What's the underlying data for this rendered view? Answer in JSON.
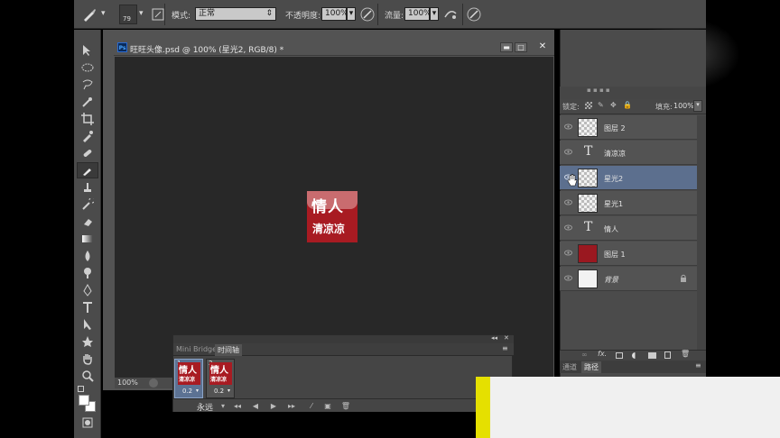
{
  "options_bar": {
    "brush_size": "79",
    "mode_label": "模式:",
    "mode_value": "正常",
    "opacity_label": "不透明度:",
    "opacity_value": "100%",
    "flow_label": "流量:",
    "flow_value": "100%"
  },
  "document": {
    "tab_title": "旺旺头像.psd @ 100% (星光2, RGB/8) *",
    "app_badge": "Ps",
    "zoom": "100%",
    "artwork": {
      "line1": "情人",
      "line2": "清凉凉",
      "color": "#a81b22"
    }
  },
  "timeline": {
    "tabs": [
      "Mini Bridge",
      "时间轴"
    ],
    "active_tab": "时间轴",
    "frames": [
      {
        "number": "1",
        "delay": "0.2",
        "thumb_line1": "情人",
        "thumb_line2": "清凉凉",
        "selected": true
      },
      {
        "number": "2",
        "delay": "0.2",
        "thumb_line1": "情人",
        "thumb_line2": "清凉凉",
        "selected": false
      }
    ],
    "loop": "永远"
  },
  "layers_panel": {
    "lock_label": "锁定:",
    "fill_label": "填充:",
    "fill_value": "100%",
    "layers": [
      {
        "name": "图层 2",
        "kind": "pixel",
        "thumb": "transparent",
        "selected": false
      },
      {
        "name": "清凉凉",
        "kind": "text",
        "thumb": "text",
        "selected": false
      },
      {
        "name": "星光2",
        "kind": "pixel",
        "thumb": "transparent",
        "selected": true
      },
      {
        "name": "星光1",
        "kind": "pixel",
        "thumb": "transparent",
        "selected": false
      },
      {
        "name": "情人",
        "kind": "text",
        "thumb": "text",
        "selected": false
      },
      {
        "name": "图层 1",
        "kind": "pixel",
        "thumb": "red",
        "selected": false
      },
      {
        "name": "背景",
        "kind": "background",
        "thumb": "white",
        "selected": false,
        "locked": true
      }
    ],
    "bottom_tabs": [
      "通道",
      "路径"
    ],
    "active_bottom_tab": "路径"
  },
  "colors": {
    "panel_bg": "#4b4b4b",
    "canvas_bg": "#282828",
    "selection": "#5c6f8e",
    "artwork_red": "#a81b22"
  }
}
